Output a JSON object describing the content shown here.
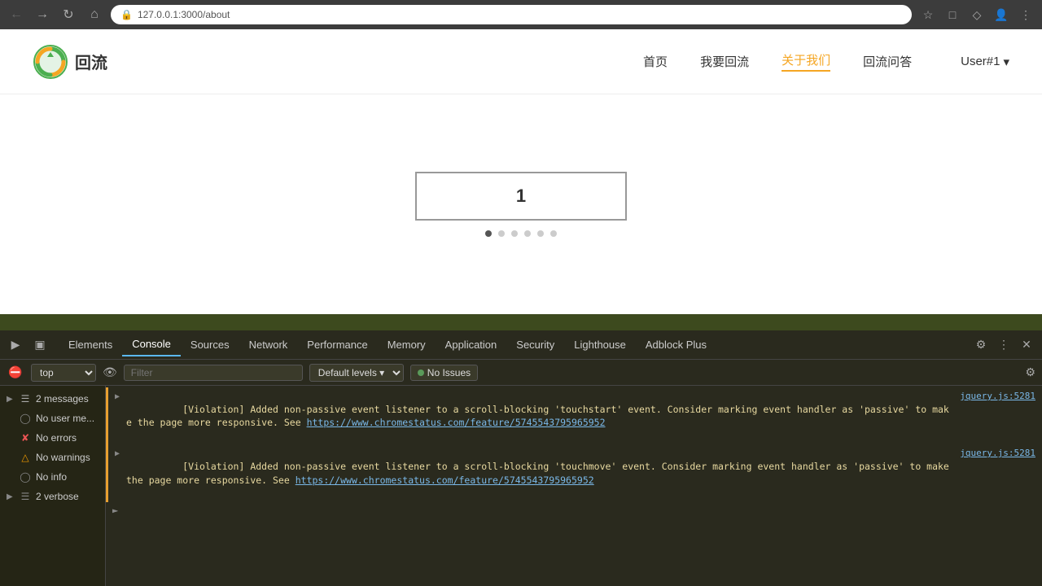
{
  "browser": {
    "url": "127.0.0.1:3000/about",
    "back_btn": "←",
    "forward_btn": "→",
    "reload_btn": "↻",
    "home_btn": "⌂",
    "lock_icon": "🔒",
    "star_btn": "☆",
    "extensions_btn": "⧉",
    "puzzle_btn": "⬡",
    "account_btn": "👤",
    "menu_btn": "⋮"
  },
  "navbar": {
    "logo_text": "回流",
    "nav_items": [
      {
        "label": "首页",
        "active": false
      },
      {
        "label": "我要回流",
        "active": false
      },
      {
        "label": "关于我们",
        "active": true
      },
      {
        "label": "回流问答",
        "active": false
      }
    ],
    "user_menu": "User#1",
    "user_dropdown": "▾"
  },
  "slider": {
    "current_value": "1",
    "dots": [
      true,
      false,
      false,
      false,
      false,
      false
    ]
  },
  "devtools": {
    "tabs": [
      {
        "label": "Elements",
        "active": false
      },
      {
        "label": "Console",
        "active": true
      },
      {
        "label": "Sources",
        "active": false
      },
      {
        "label": "Network",
        "active": false
      },
      {
        "label": "Performance",
        "active": false
      },
      {
        "label": "Memory",
        "active": false
      },
      {
        "label": "Application",
        "active": false
      },
      {
        "label": "Security",
        "active": false
      },
      {
        "label": "Lighthouse",
        "active": false
      },
      {
        "label": "Adblock Plus",
        "active": false
      }
    ],
    "console": {
      "context": "top",
      "filter_placeholder": "Filter",
      "level_select": "Default levels",
      "no_issues_label": "No Issues",
      "sidebar_items": [
        {
          "icon": "messages",
          "label": "2 messages",
          "count": "2",
          "expandable": true
        },
        {
          "icon": "user",
          "label": "No user me...",
          "expandable": false
        },
        {
          "icon": "error",
          "label": "No errors",
          "expandable": false
        },
        {
          "icon": "warning",
          "label": "No warnings",
          "expandable": false
        },
        {
          "icon": "info",
          "label": "No info",
          "expandable": false
        },
        {
          "icon": "verbose",
          "label": "2 verbose",
          "count": "2",
          "expandable": true
        }
      ],
      "logs": [
        {
          "type": "violation",
          "text_before": "[Violation] Added non-passive event listener to a scroll-blocking 'touchstart' event. Consider marking event handler as 'passive' to make the page more responsive. See ",
          "link": "https://www.chromestatus.com/feature/5745543795965952",
          "source": "jquery.js:5281",
          "expanded": false
        },
        {
          "type": "violation",
          "text_before": "[Violation] Added non-passive event listener to a scroll-blocking 'touchmove' event. Consider marking event handler as 'passive' to make the page more responsive. See ",
          "link": "https://www.chromestatus.com/feature/5745543795965952",
          "source": "jquery.js:5281",
          "expanded": false
        }
      ]
    }
  }
}
